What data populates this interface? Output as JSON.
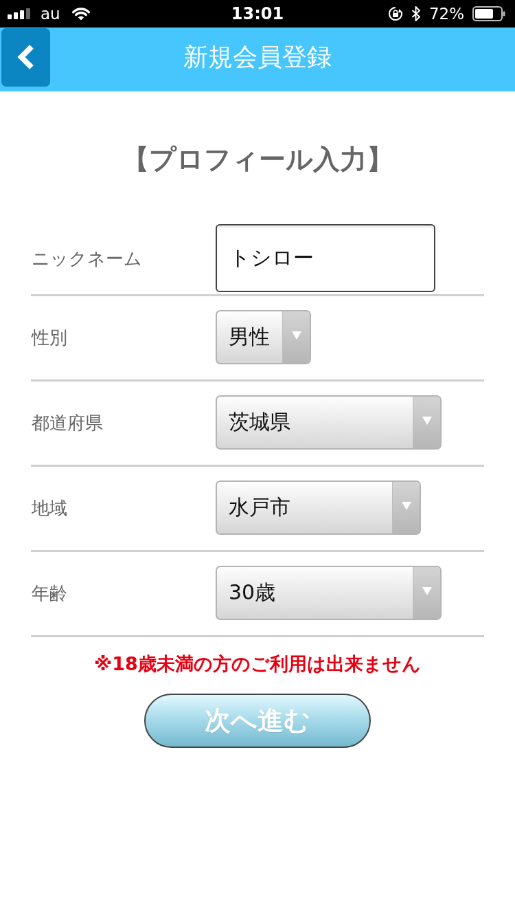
{
  "status_bar": {
    "carrier": "au",
    "time": "13:01",
    "battery": "72%"
  },
  "header": {
    "title": "新規会員登録"
  },
  "section_title": "【プロフィール入力】",
  "fields": [
    {
      "kind": "text",
      "label": "ニックネーム",
      "value": "トシロー"
    },
    {
      "kind": "select",
      "label": "性別",
      "value": "男性"
    },
    {
      "kind": "select",
      "label": "都道府県",
      "value": "茨城県"
    },
    {
      "kind": "select",
      "label": "地域",
      "value": "水戸市"
    },
    {
      "kind": "select",
      "label": "年齢",
      "value": "30歳"
    }
  ],
  "notice": "※18歳未満の方のご利用は出来ません",
  "next_button": {
    "label": "次へ進む"
  }
}
